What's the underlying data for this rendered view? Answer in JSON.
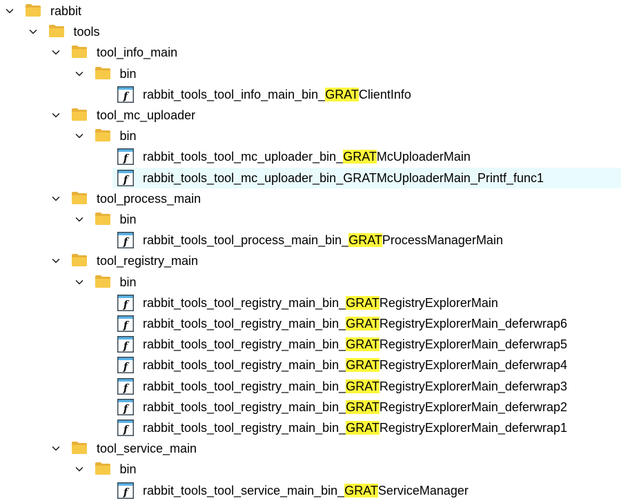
{
  "colors": {
    "highlight": "#fdf73a",
    "selected_row": "#e9fbfc",
    "folder": "#f7c948"
  },
  "tree": [
    {
      "type": "folder",
      "depth": 0,
      "label": "rabbit"
    },
    {
      "type": "folder",
      "depth": 1,
      "label": "tools"
    },
    {
      "type": "folder",
      "depth": 2,
      "label": "tool_info_main"
    },
    {
      "type": "folder",
      "depth": 3,
      "label": "bin"
    },
    {
      "type": "func",
      "depth": 4,
      "pre": "rabbit_tools_tool_info_main_bin_",
      "hl": "GRAT",
      "post": "ClientInfo"
    },
    {
      "type": "folder",
      "depth": 2,
      "label": "tool_mc_uploader"
    },
    {
      "type": "folder",
      "depth": 3,
      "label": "bin"
    },
    {
      "type": "func",
      "depth": 4,
      "pre": "rabbit_tools_tool_mc_uploader_bin_",
      "hl": "GRAT",
      "post": "McUploaderMain"
    },
    {
      "type": "func",
      "depth": 4,
      "pre": "rabbit_tools_tool_mc_uploader_bin_",
      "hl": "GRAT",
      "post": "McUploaderMain_Printf_func1",
      "selected": true
    },
    {
      "type": "folder",
      "depth": 2,
      "label": "tool_process_main"
    },
    {
      "type": "folder",
      "depth": 3,
      "label": "bin"
    },
    {
      "type": "func",
      "depth": 4,
      "pre": "rabbit_tools_tool_process_main_bin_",
      "hl": "GRAT",
      "post": "ProcessManagerMain"
    },
    {
      "type": "folder",
      "depth": 2,
      "label": "tool_registry_main"
    },
    {
      "type": "folder",
      "depth": 3,
      "label": "bin"
    },
    {
      "type": "func",
      "depth": 4,
      "pre": "rabbit_tools_tool_registry_main_bin_",
      "hl": "GRAT",
      "post": "RegistryExplorerMain"
    },
    {
      "type": "func",
      "depth": 4,
      "pre": "rabbit_tools_tool_registry_main_bin_",
      "hl": "GRAT",
      "post": "RegistryExplorerMain_deferwrap6"
    },
    {
      "type": "func",
      "depth": 4,
      "pre": "rabbit_tools_tool_registry_main_bin_",
      "hl": "GRAT",
      "post": "RegistryExplorerMain_deferwrap5"
    },
    {
      "type": "func",
      "depth": 4,
      "pre": "rabbit_tools_tool_registry_main_bin_",
      "hl": "GRAT",
      "post": "RegistryExplorerMain_deferwrap4"
    },
    {
      "type": "func",
      "depth": 4,
      "pre": "rabbit_tools_tool_registry_main_bin_",
      "hl": "GRAT",
      "post": "RegistryExplorerMain_deferwrap3"
    },
    {
      "type": "func",
      "depth": 4,
      "pre": "rabbit_tools_tool_registry_main_bin_",
      "hl": "GRAT",
      "post": "RegistryExplorerMain_deferwrap2"
    },
    {
      "type": "func",
      "depth": 4,
      "pre": "rabbit_tools_tool_registry_main_bin_",
      "hl": "GRAT",
      "post": "RegistryExplorerMain_deferwrap1"
    },
    {
      "type": "folder",
      "depth": 2,
      "label": "tool_service_main"
    },
    {
      "type": "folder",
      "depth": 3,
      "label": "bin"
    },
    {
      "type": "func",
      "depth": 4,
      "pre": "rabbit_tools_tool_service_main_bin_",
      "hl": "GRAT",
      "post": "ServiceManager"
    }
  ]
}
